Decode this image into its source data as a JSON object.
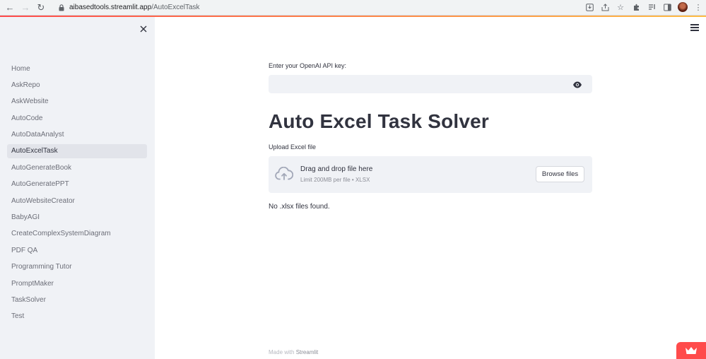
{
  "browser": {
    "url_host": "aibasedtools.streamlit.app",
    "url_path": "/AutoExcelTask"
  },
  "sidebar": {
    "items": [
      {
        "label": "Home",
        "active": false
      },
      {
        "label": "AskRepo",
        "active": false
      },
      {
        "label": "AskWebsite",
        "active": false
      },
      {
        "label": "AutoCode",
        "active": false
      },
      {
        "label": "AutoDataAnalyst",
        "active": false
      },
      {
        "label": "AutoExcelTask",
        "active": true
      },
      {
        "label": "AutoGenerateBook",
        "active": false
      },
      {
        "label": "AutoGeneratePPT",
        "active": false
      },
      {
        "label": "AutoWebsiteCreator",
        "active": false
      },
      {
        "label": "BabyAGI",
        "active": false
      },
      {
        "label": "CreateComplexSystemDiagram",
        "active": false
      },
      {
        "label": "PDF QA",
        "active": false
      },
      {
        "label": "Programming Tutor",
        "active": false
      },
      {
        "label": "PromptMaker",
        "active": false
      },
      {
        "label": "TaskSolver",
        "active": false
      },
      {
        "label": "Test",
        "active": false
      }
    ]
  },
  "main": {
    "api_label": "Enter your OpenAI API key:",
    "api_value": "",
    "title": "Auto Excel Task Solver",
    "upload_label": "Upload Excel file",
    "dropzone_main": "Drag and drop file here",
    "dropzone_sub": "Limit 200MB per file • XLSX",
    "browse_label": "Browse files",
    "no_files": "No .xlsx files found."
  },
  "footer": {
    "made_with": "Made with",
    "brand": "Streamlit"
  },
  "colors": {
    "accent": "#ff4b4b",
    "sidebar_bg": "#f0f2f6",
    "text": "#31333f"
  }
}
